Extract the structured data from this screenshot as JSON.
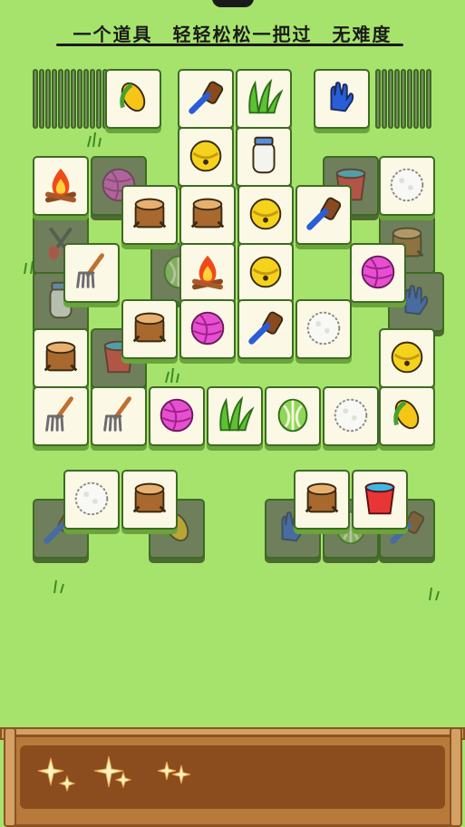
{
  "banner": {
    "text": "一个道具　轻轻松松一把过　无难度"
  },
  "tiles": [
    {
      "icon": "corn",
      "dim": false
    },
    {
      "icon": "brush",
      "dim": false
    },
    {
      "icon": "grass",
      "dim": false
    },
    {
      "icon": "glove",
      "dim": false
    },
    {
      "icon": "bell",
      "dim": false
    },
    {
      "icon": "bottle",
      "dim": false
    },
    {
      "icon": "fire",
      "dim": false
    },
    {
      "icon": "yarn",
      "dim": true
    },
    {
      "icon": "bucket",
      "dim": true
    },
    {
      "icon": "rice",
      "dim": false
    },
    {
      "icon": "stump",
      "dim": false
    },
    {
      "icon": "stump",
      "dim": false
    },
    {
      "icon": "bell",
      "dim": false
    },
    {
      "icon": "brush",
      "dim": false
    },
    {
      "icon": "scissors",
      "dim": true
    },
    {
      "icon": "stump",
      "dim": true
    },
    {
      "icon": "rake",
      "dim": false
    },
    {
      "icon": "fire",
      "dim": false
    },
    {
      "icon": "bell",
      "dim": false
    },
    {
      "icon": "yarn",
      "dim": false
    },
    {
      "icon": "bottle",
      "dim": true
    },
    {
      "icon": "cabbage",
      "dim": true
    },
    {
      "icon": "glove",
      "dim": true
    },
    {
      "icon": "stump",
      "dim": false
    },
    {
      "icon": "yarn",
      "dim": false
    },
    {
      "icon": "brush",
      "dim": false
    },
    {
      "icon": "rice",
      "dim": false
    },
    {
      "icon": "stump",
      "dim": false
    },
    {
      "icon": "bucket",
      "dim": true
    },
    {
      "icon": "bell",
      "dim": false
    },
    {
      "icon": "rake",
      "dim": false
    },
    {
      "icon": "rake",
      "dim": false
    },
    {
      "icon": "yarn",
      "dim": false
    },
    {
      "icon": "grass",
      "dim": false
    },
    {
      "icon": "cabbage",
      "dim": false
    },
    {
      "icon": "rice",
      "dim": false
    },
    {
      "icon": "corn",
      "dim": false
    },
    {
      "icon": "rice",
      "dim": false
    },
    {
      "icon": "stump",
      "dim": false
    },
    {
      "icon": "stump",
      "dim": false
    },
    {
      "icon": "bucket",
      "dim": false
    },
    {
      "icon": "brush",
      "dim": true
    },
    {
      "icon": "corn",
      "dim": true
    },
    {
      "icon": "glove",
      "dim": true
    },
    {
      "icon": "cabbage",
      "dim": true
    },
    {
      "icon": "brush",
      "dim": true
    }
  ],
  "tray": {
    "slots": 7,
    "filled": 0
  },
  "colors": {
    "background": "#a6e36c",
    "tile": "#fbf8e6",
    "tile_border": "#3d6b22",
    "tray": "#8b4d1e"
  }
}
